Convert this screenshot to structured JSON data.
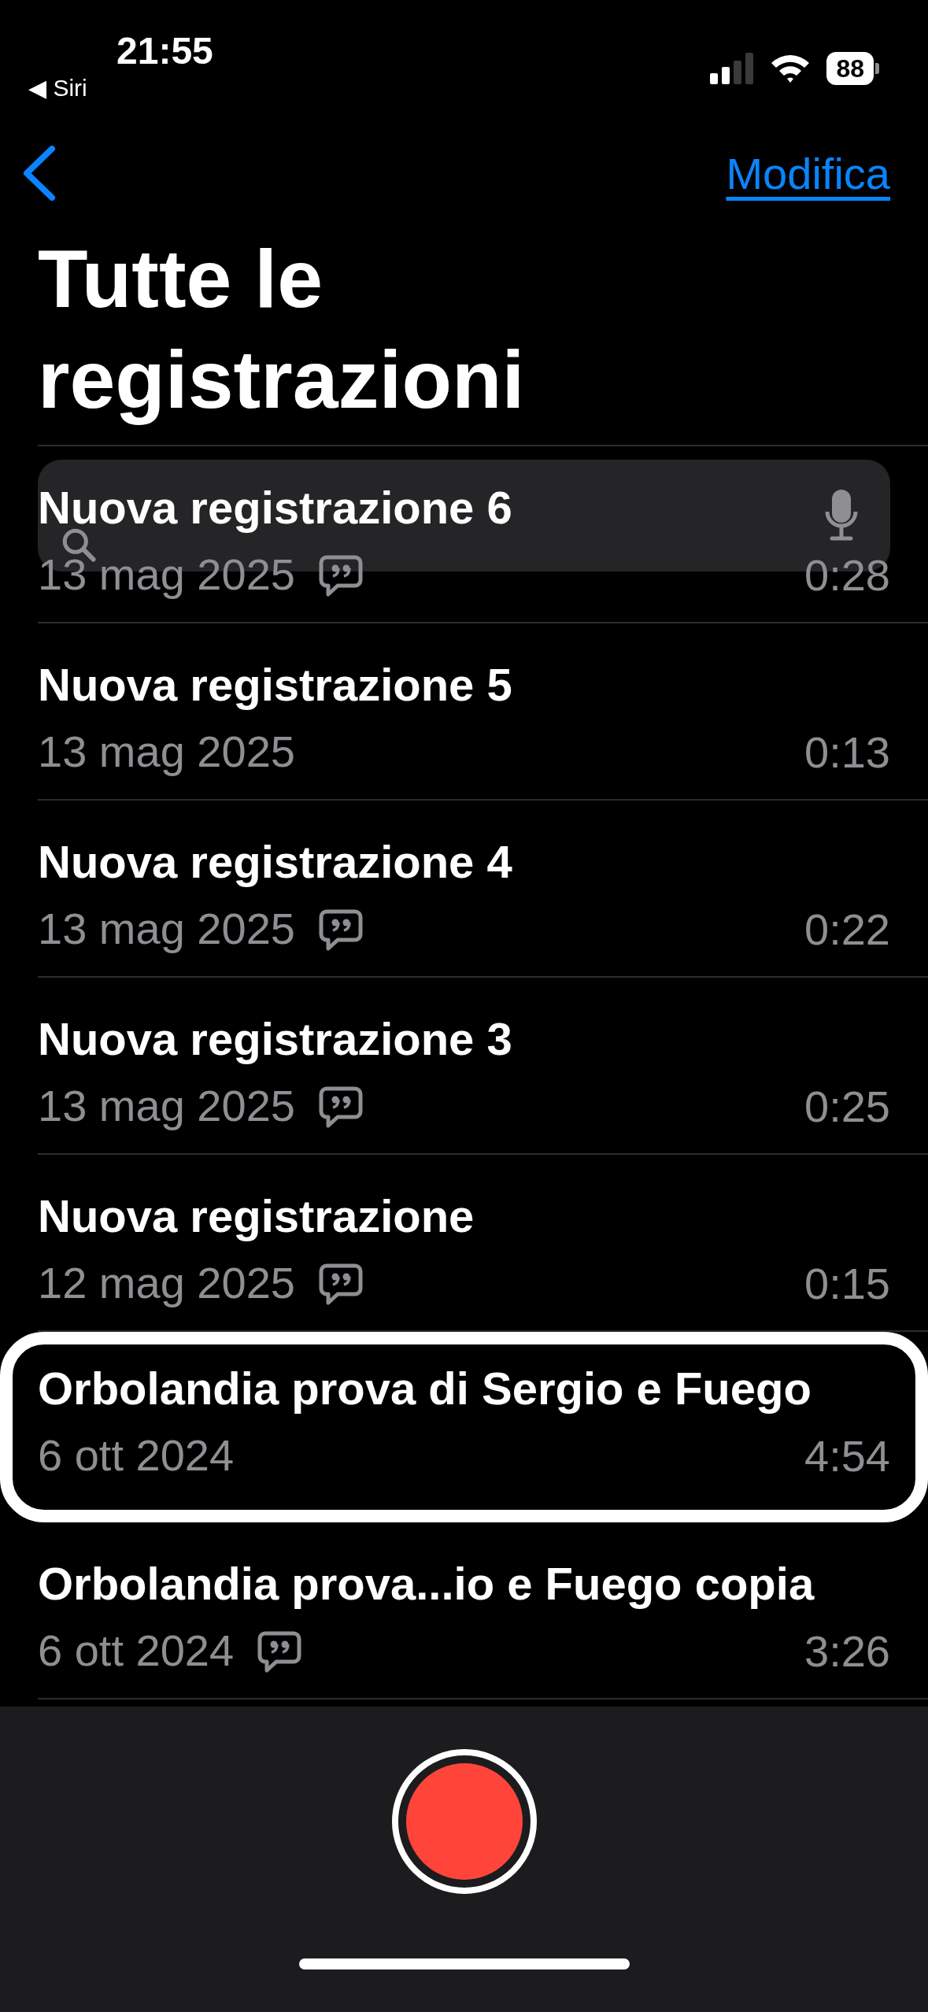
{
  "status_bar": {
    "time": "21:55",
    "back_app": "◀ Siri",
    "battery": "88"
  },
  "nav": {
    "edit_link": "Modifica"
  },
  "title": "Tutte le registrazioni",
  "recordings": [
    {
      "title": "Nuova registrazione 6",
      "date": "13 mag 2025",
      "duration": "0:28",
      "transcript": true,
      "selected": false
    },
    {
      "title": "Nuova registrazione 5",
      "date": "13 mag 2025",
      "duration": "0:13",
      "transcript": false,
      "selected": false
    },
    {
      "title": "Nuova registrazione 4",
      "date": "13 mag 2025",
      "duration": "0:22",
      "transcript": true,
      "selected": false
    },
    {
      "title": "Nuova registrazione 3",
      "date": "13 mag 2025",
      "duration": "0:25",
      "transcript": true,
      "selected": false
    },
    {
      "title": "Nuova registrazione",
      "date": "12 mag 2025",
      "duration": "0:15",
      "transcript": true,
      "selected": false
    },
    {
      "title": "Orbolandia prova di Sergio e Fuego",
      "date": "6 ott 2024",
      "duration": "4:54",
      "transcript": false,
      "selected": true
    },
    {
      "title": "Orbolandia prova...io e Fuego copia",
      "date": "6 ott 2024",
      "duration": "3:26",
      "transcript": true,
      "selected": false
    }
  ]
}
